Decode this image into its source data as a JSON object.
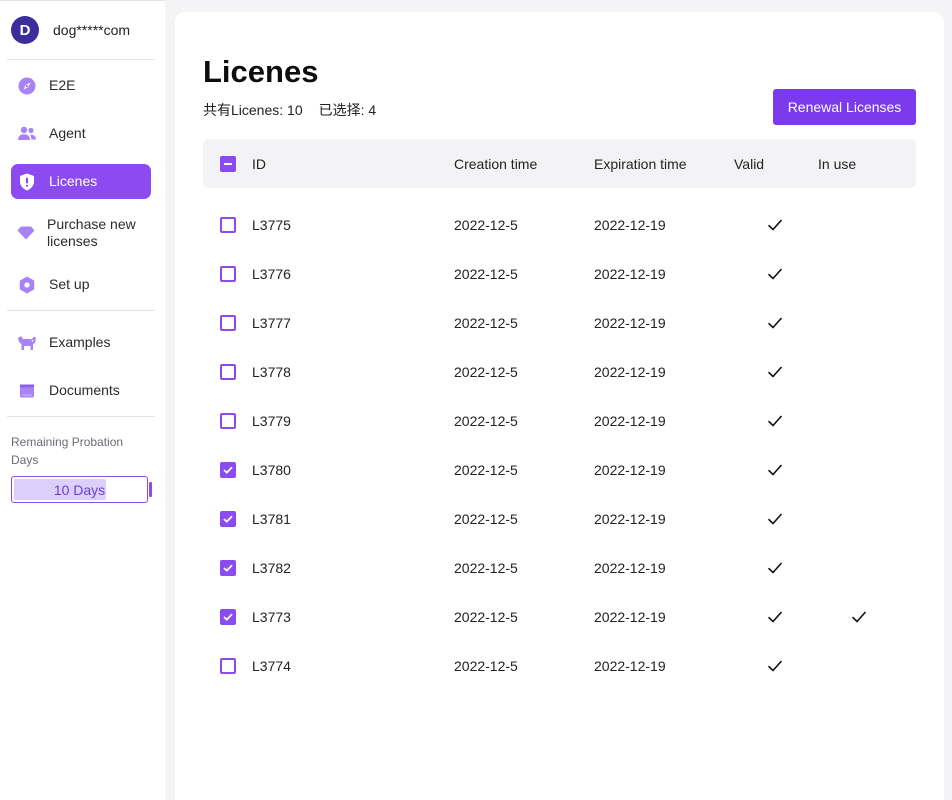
{
  "account": {
    "initial": "D",
    "name": "dog*****com"
  },
  "sidebar": {
    "items": [
      {
        "label": "E2E",
        "icon": "compass-icon",
        "active": false
      },
      {
        "label": "Agent",
        "icon": "users-icon",
        "active": false
      },
      {
        "label": "Licenes",
        "icon": "shield-icon",
        "active": true
      },
      {
        "label": "Purchase new licenses",
        "icon": "diamond-icon",
        "active": false
      },
      {
        "label": "Set up",
        "icon": "hexagon-gear-icon",
        "active": false
      }
    ],
    "items2": [
      {
        "label": "Examples",
        "icon": "dog-icon"
      },
      {
        "label": "Documents",
        "icon": "book-icon"
      }
    ],
    "probation": {
      "title": "Remaining Probation Days",
      "value": "10 Days",
      "fraction": 0.69
    }
  },
  "main": {
    "title": "Licenes",
    "total_label": "共有Licenes: 10",
    "selected_label": "已选择: 4",
    "renew_button": "Renewal Licenses",
    "columns": {
      "id": "ID",
      "created": "Creation time",
      "expires": "Expiration time",
      "valid": "Valid",
      "inuse": "In use"
    },
    "rows": [
      {
        "id": "L3775",
        "created": "2022-12-5",
        "expires": "2022-12-19",
        "checked": false,
        "valid": true,
        "inuse": false
      },
      {
        "id": "L3776",
        "created": "2022-12-5",
        "expires": "2022-12-19",
        "checked": false,
        "valid": true,
        "inuse": false
      },
      {
        "id": "L3777",
        "created": "2022-12-5",
        "expires": "2022-12-19",
        "checked": false,
        "valid": true,
        "inuse": false
      },
      {
        "id": "L3778",
        "created": "2022-12-5",
        "expires": "2022-12-19",
        "checked": false,
        "valid": true,
        "inuse": false
      },
      {
        "id": "L3779",
        "created": "2022-12-5",
        "expires": "2022-12-19",
        "checked": false,
        "valid": true,
        "inuse": false
      },
      {
        "id": "L3780",
        "created": "2022-12-5",
        "expires": "2022-12-19",
        "checked": true,
        "valid": true,
        "inuse": false
      },
      {
        "id": "L3781",
        "created": "2022-12-5",
        "expires": "2022-12-19",
        "checked": true,
        "valid": true,
        "inuse": false
      },
      {
        "id": "L3782",
        "created": "2022-12-5",
        "expires": "2022-12-19",
        "checked": true,
        "valid": true,
        "inuse": false
      },
      {
        "id": "L3773",
        "created": "2022-12-5",
        "expires": "2022-12-19",
        "checked": true,
        "valid": true,
        "inuse": true
      },
      {
        "id": "L3774",
        "created": "2022-12-5",
        "expires": "2022-12-19",
        "checked": false,
        "valid": true,
        "inuse": false
      }
    ]
  },
  "colors": {
    "accent": "#8b4bf0",
    "button": "#7c3aed",
    "avatar": "#3d2c9c"
  }
}
